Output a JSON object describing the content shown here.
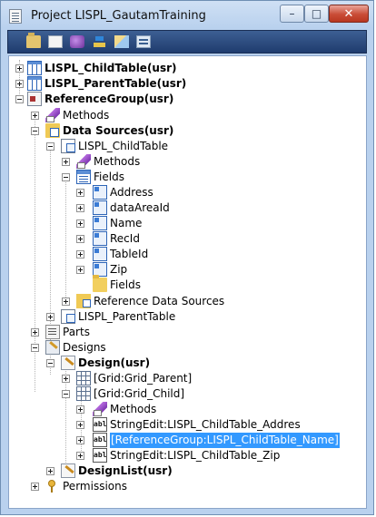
{
  "window": {
    "title": "Project LISPL_GautamTraining",
    "minimize_glyph": "–",
    "maximize_glyph": "□",
    "close_glyph": "✕"
  },
  "toolbar": {
    "buttons": [
      {
        "name": "open-folder-icon"
      },
      {
        "name": "properties-icon"
      },
      {
        "name": "compile-icon"
      },
      {
        "name": "import-icon"
      },
      {
        "name": "filter-icon"
      },
      {
        "name": "layout-icon"
      }
    ]
  },
  "tree": {
    "items": [
      {
        "label": "LISPL_ChildTable(usr)",
        "icon": "table-icon",
        "bold": true,
        "expander": "plus"
      },
      {
        "label": "LISPL_ParentTable(usr)",
        "icon": "table-icon",
        "bold": true,
        "expander": "plus"
      },
      {
        "label": "ReferenceGroup(usr)",
        "icon": "form-icon",
        "bold": true,
        "expander": "minus"
      },
      {
        "label": "Methods",
        "icon": "methods-icon",
        "bold": false,
        "expander": "plus"
      },
      {
        "label": "Data Sources(usr)",
        "icon": "datasources-icon",
        "bold": true,
        "expander": "minus"
      },
      {
        "label": "LISPL_ChildTable",
        "icon": "datasource-table-icon",
        "bold": false,
        "expander": "minus"
      },
      {
        "label": "Methods",
        "icon": "methods-icon",
        "bold": false,
        "expander": "plus"
      },
      {
        "label": "Fields",
        "icon": "fields-icon",
        "bold": false,
        "expander": "minus"
      },
      {
        "label": "Address",
        "icon": "field-icon",
        "bold": false,
        "expander": "plus"
      },
      {
        "label": "dataAreaId",
        "icon": "field-icon",
        "bold": false,
        "expander": "plus"
      },
      {
        "label": "Name",
        "icon": "field-icon",
        "bold": false,
        "expander": "plus"
      },
      {
        "label": "RecId",
        "icon": "field-icon",
        "bold": false,
        "expander": "plus"
      },
      {
        "label": "TableId",
        "icon": "field-icon",
        "bold": false,
        "expander": "plus"
      },
      {
        "label": "Zip",
        "icon": "field-icon",
        "bold": false,
        "expander": "plus"
      },
      {
        "label": "Fields",
        "icon": "folder-icon",
        "bold": false,
        "expander": "none"
      },
      {
        "label": "Reference Data Sources",
        "icon": "reference-datasources-icon",
        "bold": false,
        "expander": "plus"
      },
      {
        "label": "LISPL_ParentTable",
        "icon": "datasource-table-icon",
        "bold": false,
        "expander": "plus"
      },
      {
        "label": "Parts",
        "icon": "parts-icon",
        "bold": false,
        "expander": "plus"
      },
      {
        "label": "Designs",
        "icon": "designs-icon",
        "bold": false,
        "expander": "minus"
      },
      {
        "label": "Design(usr)",
        "icon": "design-icon",
        "bold": true,
        "expander": "minus"
      },
      {
        "label": "[Grid:Grid_Parent]",
        "icon": "grid-icon",
        "bold": false,
        "expander": "plus"
      },
      {
        "label": "[Grid:Grid_Child]",
        "icon": "grid-icon",
        "bold": false,
        "expander": "minus"
      },
      {
        "label": "Methods",
        "icon": "methods-icon",
        "bold": false,
        "expander": "plus"
      },
      {
        "label": "StringEdit:LISPL_ChildTable_Addres",
        "icon": "stringedit-icon",
        "bold": false,
        "expander": "plus"
      },
      {
        "label": "[ReferenceGroup:LISPL_ChildTable_Name]",
        "icon": "stringedit-icon",
        "bold": false,
        "expander": "plus",
        "selected": true
      },
      {
        "label": "StringEdit:LISPL_ChildTable_Zip",
        "icon": "stringedit-icon",
        "bold": false,
        "expander": "plus"
      },
      {
        "label": "DesignList(usr)",
        "icon": "design-icon",
        "bold": true,
        "expander": "plus"
      },
      {
        "label": "Permissions",
        "icon": "key-icon",
        "bold": false,
        "expander": "plus"
      }
    ],
    "abl_glyph": "abl"
  }
}
